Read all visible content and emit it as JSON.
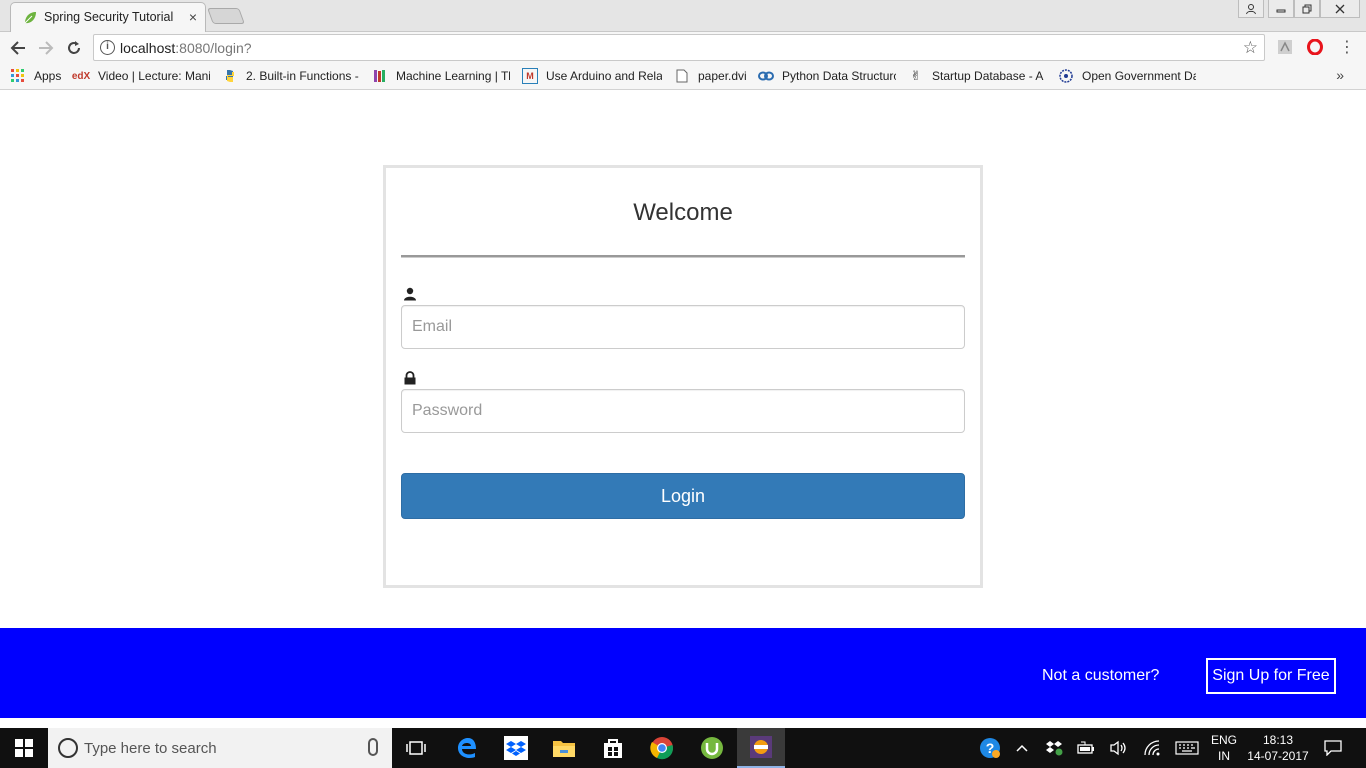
{
  "browser": {
    "tab_title": "Spring Security Tutorial",
    "tab_close": "×",
    "url_host": "localhost",
    "url_path": ":8080/login?",
    "bookmarks": [
      {
        "label": "Apps",
        "icon": "apps-grid-icon"
      },
      {
        "label": "Video | Lecture: Mani",
        "icon": "edx-icon"
      },
      {
        "label": "2. Built-in Functions -",
        "icon": "python-icon"
      },
      {
        "label": "Machine Learning | Tl",
        "icon": "books-icon"
      },
      {
        "label": "Use Arduino and Rela",
        "icon": "instructables-icon"
      },
      {
        "label": "paper.dvi",
        "icon": "document-icon"
      },
      {
        "label": "Python Data Structurc",
        "icon": "link-icon"
      },
      {
        "label": "Startup Database - Ai",
        "icon": "victory-hand-icon"
      },
      {
        "label": "Open Government Da",
        "icon": "government-icon"
      }
    ],
    "more_bookmarks": "»"
  },
  "login": {
    "heading": "Welcome",
    "email_placeholder": "Email",
    "password_placeholder": "Password",
    "submit_label": "Login"
  },
  "footer": {
    "question": "Not a customer?",
    "signup_label": "Sign Up for Free",
    "background_color": "#0000ff"
  },
  "taskbar": {
    "search_placeholder": "Type here to search",
    "language_line1": "ENG",
    "language_line2": "IN",
    "time": "18:13",
    "date": "14-07-2017"
  },
  "colors": {
    "login_button": "#337ab7",
    "footer": "#0000ff"
  }
}
